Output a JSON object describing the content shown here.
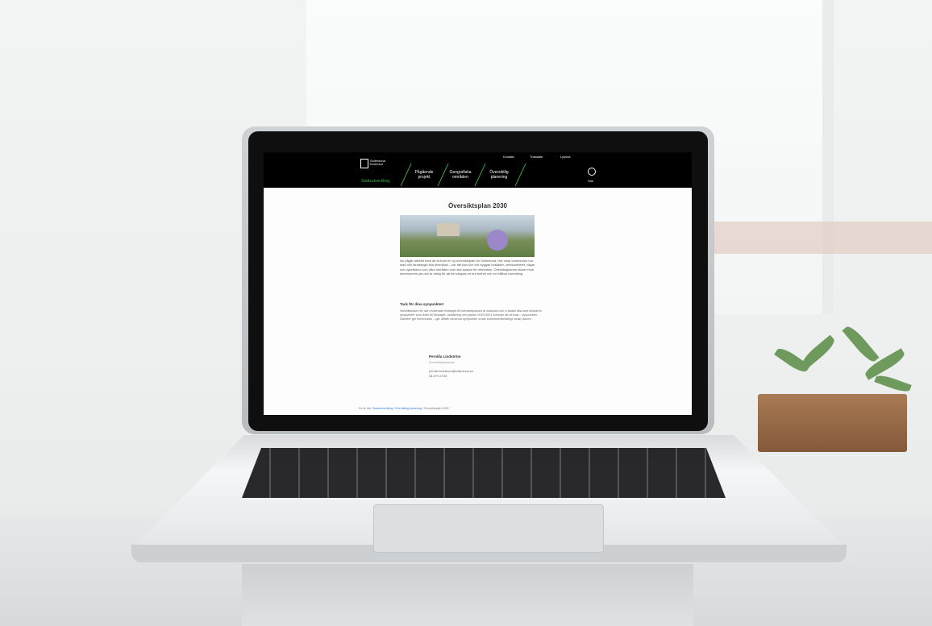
{
  "site": {
    "logo_text": "Sollentuna Kommun",
    "nav_active": "Stadsutveckling",
    "nav_items": [
      "Pågående projekt",
      "Geografiska områden",
      "Översiktlig planering"
    ],
    "utility": [
      "Kontakt",
      "Translate",
      "Lyssna"
    ],
    "search_label": "Sök"
  },
  "page": {
    "title": "Översiktsplan 2030",
    "intro": "Nu pågår arbetet med att ta fram en ny översiktsplan för Sollentuna. Här visar kommunen hur stad och landsbygd ska utvecklas – var det kan och bör byggas bostäder, verksamheter, vägar och cykelbanor och vilka områden som ska sparas för rekreation. Översiktsplanen täcker hela kommunens yta och är viktig för att det skapas en bra helhet och en hållbar utveckling.",
    "subheading": "Tack för dina synpunkter!",
    "body": "Samrådstiden för det reviderade förslaget till översiktsplanen är avslutad och vi tackar alla som skickat in synpunkter som leder till förslaget. Utställning om planen 2020-2021 kommer att bli kvar... synpunkter. Därefter ger kommunen ...gar utifrån inkomna synpunkter innan kommunfullmäktige antar planen.",
    "contact": {
      "name": "Pernilla Lindström",
      "role": "Översiktsplanerare",
      "email": "pernilla.lindstrom@sollentuna.se",
      "phone": "08-579 22 88"
    },
    "breadcrumb": {
      "prefix": "Du är här:",
      "links": [
        "Stadsutveckling",
        "Översiktlig planering"
      ],
      "current": "Översiktsplan 2030"
    }
  }
}
